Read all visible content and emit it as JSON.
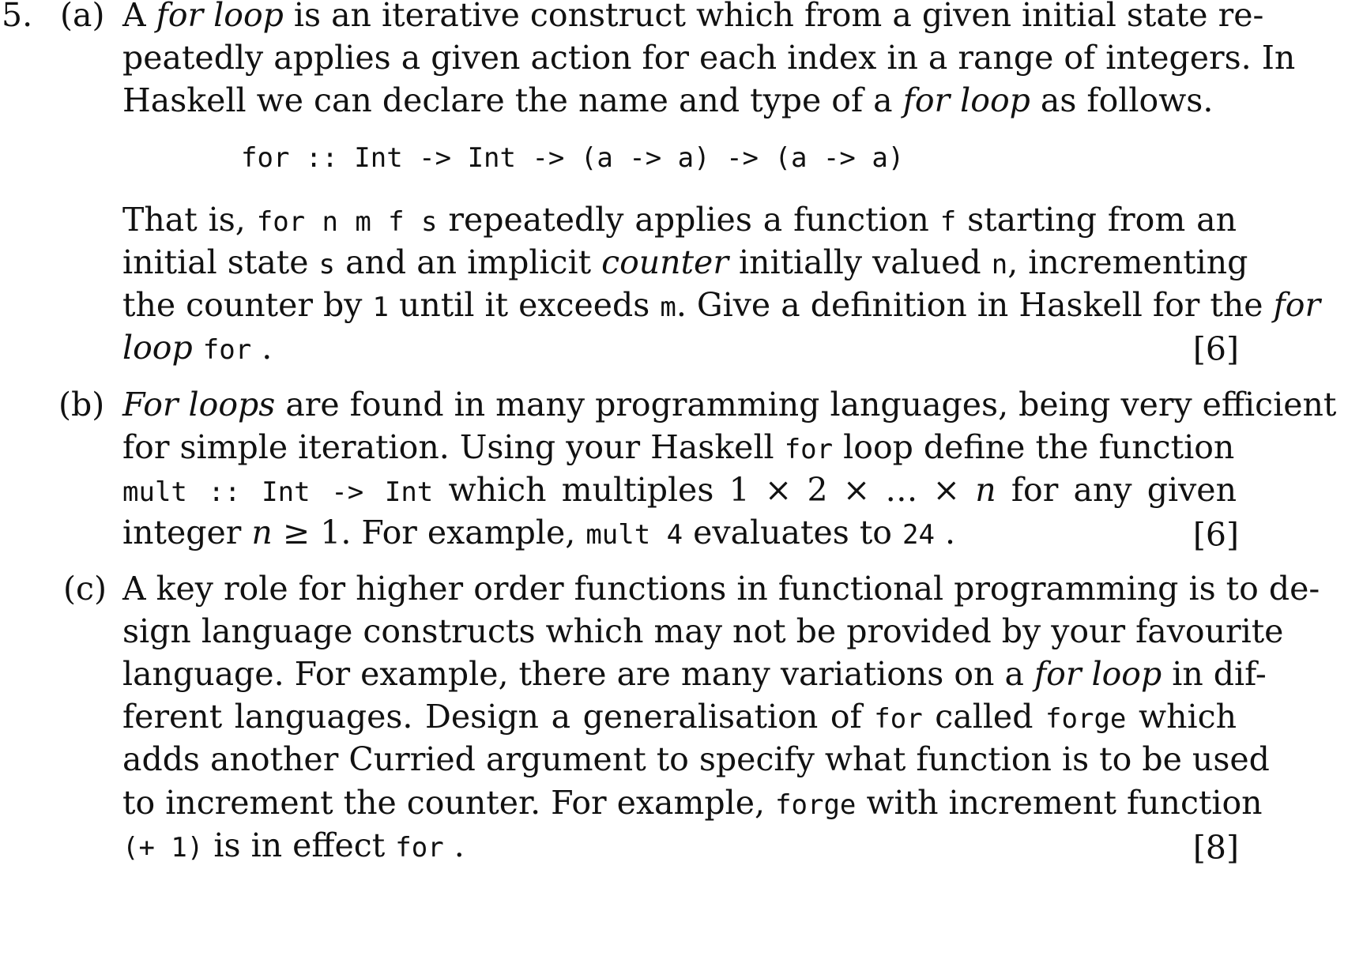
{
  "question": {
    "number": "5.",
    "parts": [
      {
        "label": "(a)",
        "lines": [
          {
            "segments": [
              {
                "t": "A "
              },
              {
                "t": "for loop",
                "i": true
              },
              {
                "t": " is an iterative construct which from a given initial state re-"
              }
            ]
          },
          {
            "segments": [
              {
                "t": "peatedly applies a given action for each index in a range of integers. In"
              }
            ]
          },
          {
            "segments": [
              {
                "t": "Haskell we can declare the name and type of a "
              },
              {
                "t": "for loop",
                "i": true
              },
              {
                "t": " as follows."
              }
            ],
            "last": true
          }
        ],
        "code": "for :: Int -> Int -> (a -> a) -> (a -> a)",
        "lines2": [
          {
            "segments": [
              {
                "t": "That is, "
              },
              {
                "t": "for n m f s",
                "c": true
              },
              {
                "t": " repeatedly applies a function "
              },
              {
                "t": "f",
                "c": true
              },
              {
                "t": " starting from an"
              }
            ]
          },
          {
            "segments": [
              {
                "t": "initial state "
              },
              {
                "t": "s",
                "c": true
              },
              {
                "t": " and an implicit "
              },
              {
                "t": "counter",
                "i": true
              },
              {
                "t": " initially valued "
              },
              {
                "t": "n",
                "c": true
              },
              {
                "t": ", incrementing"
              }
            ]
          },
          {
            "segments": [
              {
                "t": "the counter by "
              },
              {
                "t": "1",
                "c": true
              },
              {
                "t": " until it exceeds "
              },
              {
                "t": "m",
                "c": true
              },
              {
                "t": ". Give a definition in Haskell for the "
              },
              {
                "t": "for",
                "i": true
              }
            ]
          },
          {
            "segments": [
              {
                "t": "loop",
                "i": true
              },
              {
                "t": " "
              },
              {
                "t": "for",
                "c": true
              },
              {
                "t": " ."
              }
            ],
            "last": true
          }
        ],
        "marks": "[6]"
      },
      {
        "label": "(b)",
        "lines": [
          {
            "segments": [
              {
                "t": "For loops",
                "i": true
              },
              {
                "t": " are found in many programming languages, being very efficient"
              }
            ]
          },
          {
            "segments": [
              {
                "t": "for simple iteration. Using your Haskell "
              },
              {
                "t": "for",
                "c": true
              },
              {
                "t": " loop define the function"
              }
            ],
            "last": true
          },
          {
            "segments": [
              {
                "t": "mult :: Int -> Int",
                "c": true
              },
              {
                "t": " which multiples "
              },
              {
                "t": "1 × 2 ×  …  × ",
                "m": true
              },
              {
                "t": "n",
                "mi": true
              },
              {
                "t": " for any given"
              }
            ]
          },
          {
            "segments": [
              {
                "t": "integer "
              },
              {
                "t": "n",
                "mi": true
              },
              {
                "t": " ≥ 1",
                "m": true
              },
              {
                "t": ". For example, "
              },
              {
                "t": "mult 4",
                "c": true
              },
              {
                "t": " evaluates to "
              },
              {
                "t": "24",
                "c": true
              },
              {
                "t": " ."
              }
            ],
            "last": true
          }
        ],
        "marks": "[6]"
      },
      {
        "label": "(c)",
        "lines": [
          {
            "segments": [
              {
                "t": "A key role for higher order functions in functional programming is to de-"
              }
            ]
          },
          {
            "segments": [
              {
                "t": "sign language constructs which may not be provided by your favourite"
              }
            ]
          },
          {
            "segments": [
              {
                "t": "language. For example, there are many variations on a "
              },
              {
                "t": "for loop",
                "i": true
              },
              {
                "t": " in dif-"
              }
            ]
          },
          {
            "segments": [
              {
                "t": "ferent languages. Design a generalisation of "
              },
              {
                "t": "for",
                "c": true
              },
              {
                "t": " called "
              },
              {
                "t": "forge",
                "c": true
              },
              {
                "t": " which"
              }
            ]
          },
          {
            "segments": [
              {
                "t": "adds another Curried argument to specify what function is to be used"
              }
            ]
          },
          {
            "segments": [
              {
                "t": "to increment the counter. For example, "
              },
              {
                "t": "forge",
                "c": true
              },
              {
                "t": " with increment function"
              }
            ]
          },
          {
            "segments": [
              {
                "t": "(+ 1)",
                "c": true
              },
              {
                "t": " is in effect "
              },
              {
                "t": "for",
                "c": true
              },
              {
                "t": " ."
              }
            ],
            "last": true
          }
        ],
        "marks": "[8]"
      }
    ]
  }
}
